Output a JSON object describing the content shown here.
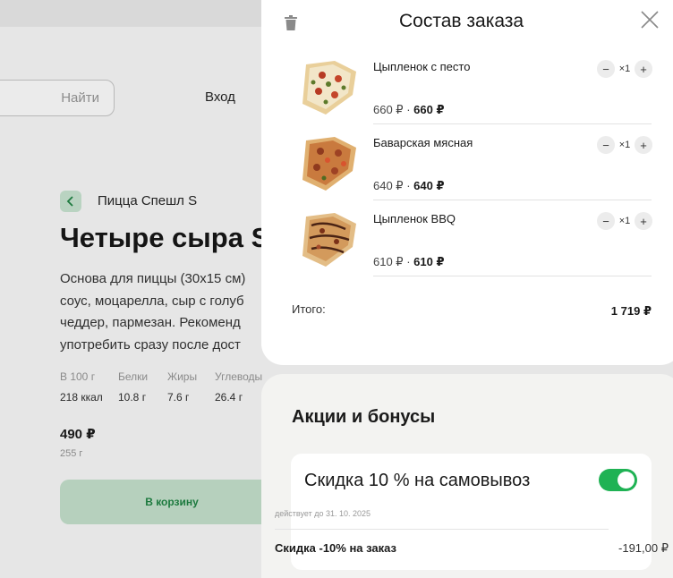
{
  "background": {
    "search_button": "Найти",
    "login": "Вход",
    "breadcrumb": "Пицца Спешл S",
    "title": "Четыре сыра S",
    "description": "Основа для пиццы (30x15 см)\nсоус, моцарелла, сыр с голуб\nчеддер, пармезан. Рекоменд\nупотребить сразу после дост",
    "nutrition": {
      "headers": [
        "В 100 г",
        "Белки",
        "Жиры",
        "Углеводы"
      ],
      "values": [
        "218 ккал",
        "10.8 г",
        "7.6 г",
        "26.4 г"
      ]
    },
    "price": "490 ₽",
    "weight": "255 г",
    "add_to_cart": "В корзину"
  },
  "order": {
    "title": "Состав заказа",
    "items": [
      {
        "name": "Цыпленок с песто",
        "qty": "×1",
        "price": "660 ₽",
        "total": "660 ₽"
      },
      {
        "name": "Баварская мясная",
        "qty": "×1",
        "price": "640 ₽",
        "total": "640 ₽"
      },
      {
        "name": "Цыпленок BBQ",
        "qty": "×1",
        "price": "610 ₽",
        "total": "610 ₽"
      }
    ],
    "total_label": "Итого:",
    "total_value": "1 719 ₽"
  },
  "promo": {
    "title": "Акции и бонусы",
    "card": {
      "name": "Скидка 10 % на самовывоз",
      "valid_until": "действует до 31. 10. 2025",
      "discount_label": "Скидка -10% на заказ",
      "discount_value": "-191,00 ₽",
      "enabled": true
    }
  },
  "colors": {
    "accent": "#1fb254",
    "dim_overlay": "#e6e6e6"
  }
}
